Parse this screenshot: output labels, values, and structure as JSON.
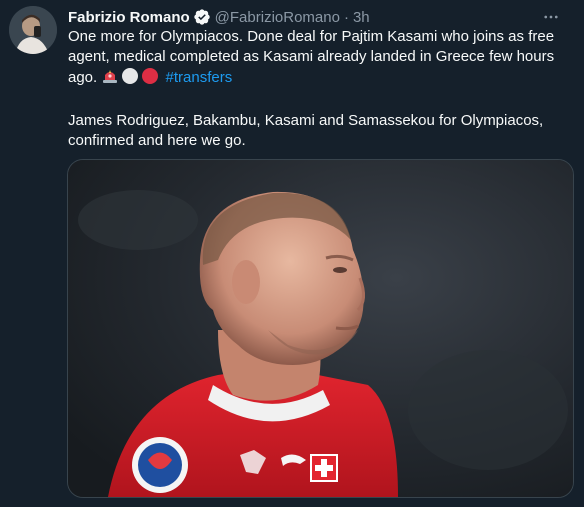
{
  "author": {
    "display_name": "Fabrizio Romano",
    "handle": "@FabrizioRomano",
    "separator": "·",
    "time": "3h",
    "verified_icon": "verified-badge-icon",
    "avatar_icon": "avatar"
  },
  "tweet": {
    "text_part1": "One more for Olympiacos. Done deal for Pajtim Kasami who joins as free agent, medical completed as Kasami already landed in Greece few hours ago.",
    "emojis": [
      "siren-emoji",
      "white-circle-emoji",
      "red-circle-emoji"
    ],
    "hashtag": "#transfers",
    "text_part2": "James Rodriguez, Bakambu, Kasami and Samassekou for Olympiacos, confirmed and here we go."
  },
  "more_icon": "more-icon",
  "colors": {
    "background": "#15202b",
    "text": "#f7f9f9",
    "muted": "#8b98a5",
    "accent": "#1d9bf0",
    "jersey_red": "#d8212c"
  }
}
